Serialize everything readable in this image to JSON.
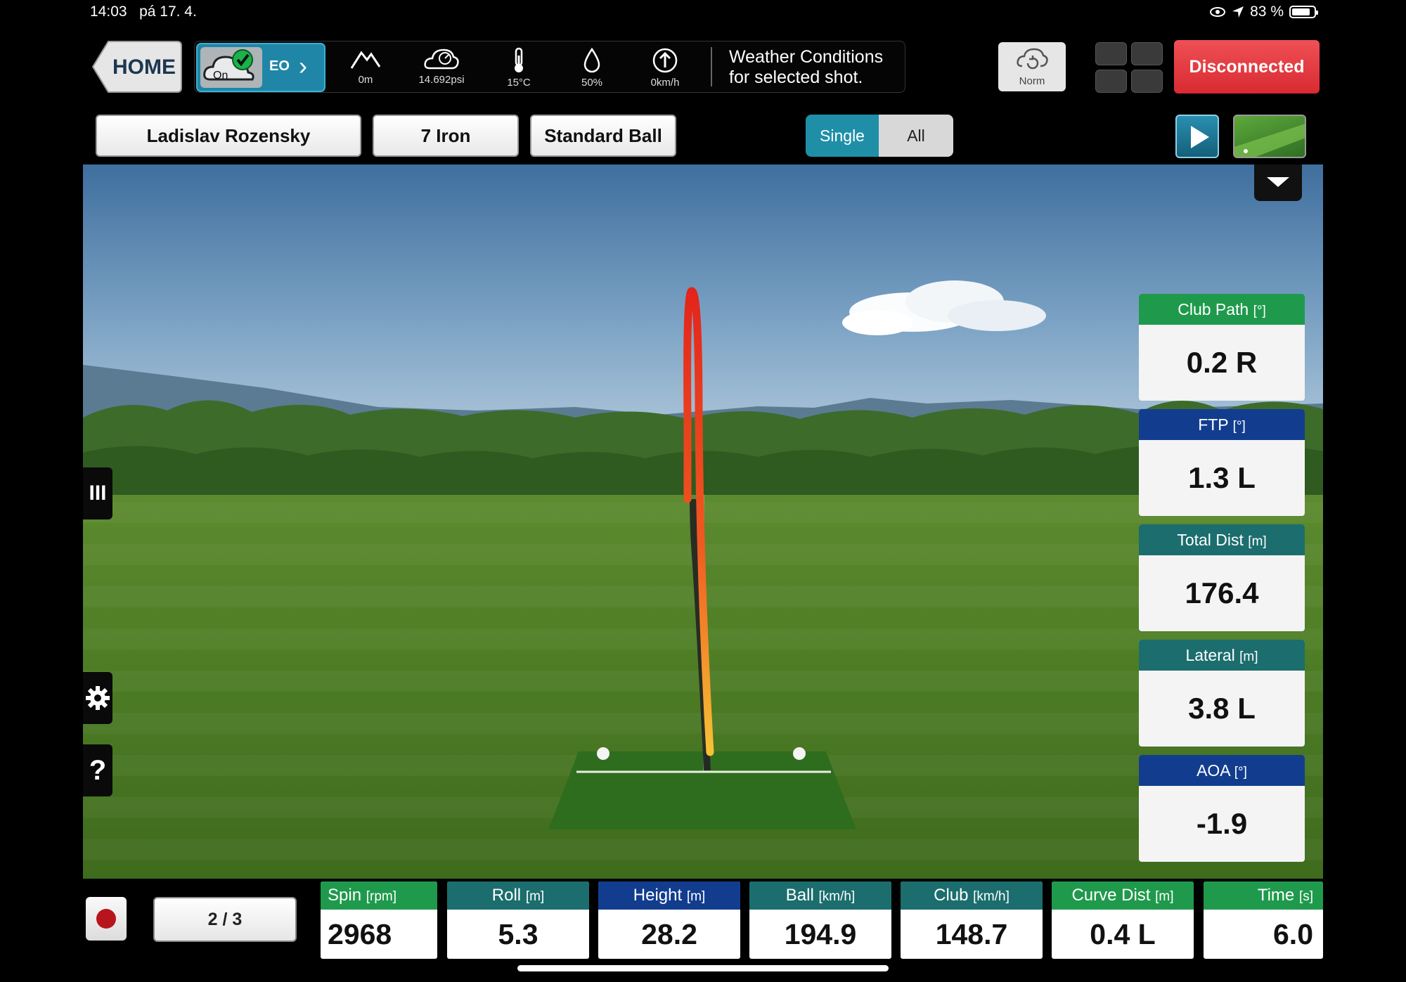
{
  "status_bar": {
    "time": "14:03",
    "date": "pá 17. 4.",
    "battery": "83 %",
    "battery_level": 0.83
  },
  "toolbar": {
    "home_label": "HOME",
    "cloud_on_label": "On",
    "eo_label": "EO",
    "weather": {
      "altitude": "0m",
      "pressure": "14.692psi",
      "temperature": "15°C",
      "humidity": "50%",
      "wind": "0km/h"
    },
    "weather_text_line1": "Weather Conditions",
    "weather_text_line2": "for selected shot.",
    "norm_label": "Norm",
    "disconnected_label": "Disconnected"
  },
  "session": {
    "player": "Ladislav Rozensky",
    "club": "7 Iron",
    "ball": "Standard Ball",
    "view_single": "Single",
    "view_all": "All"
  },
  "side_buttons": {
    "menu_glyph": "III",
    "help_glyph": "?"
  },
  "metrics_right": [
    {
      "label": "Club Path",
      "unit": "[°]",
      "value": "0.2 R"
    },
    {
      "label": "FTP",
      "unit": "[°]",
      "value": "1.3 L"
    },
    {
      "label": "Total Dist",
      "unit": "[m]",
      "value": "176.4"
    },
    {
      "label": "Lateral",
      "unit": "[m]",
      "value": "3.8 L"
    },
    {
      "label": "AOA",
      "unit": "[°]",
      "value": "-1.9"
    }
  ],
  "shot_counter": "2 / 3",
  "metrics_bottom": [
    {
      "label": "Spin",
      "unit": "[rpm]",
      "value": "2968"
    },
    {
      "label": "Roll",
      "unit": "[m]",
      "value": "5.3"
    },
    {
      "label": "Height",
      "unit": "[m]",
      "value": "28.2"
    },
    {
      "label": "Ball",
      "unit": "[km/h]",
      "value": "194.9"
    },
    {
      "label": "Club",
      "unit": "[km/h]",
      "value": "148.7"
    },
    {
      "label": "Curve Dist",
      "unit": "[m]",
      "value": "0.4 L"
    },
    {
      "label": "Time",
      "unit": "[s]",
      "value": "6.0"
    }
  ],
  "colors": {
    "green_header": "#1f9a4c",
    "teal_header": "#1c6d6e",
    "navy_header": "#123d8f",
    "disconnected": "#e0383e",
    "accent": "#1f8fa8"
  }
}
